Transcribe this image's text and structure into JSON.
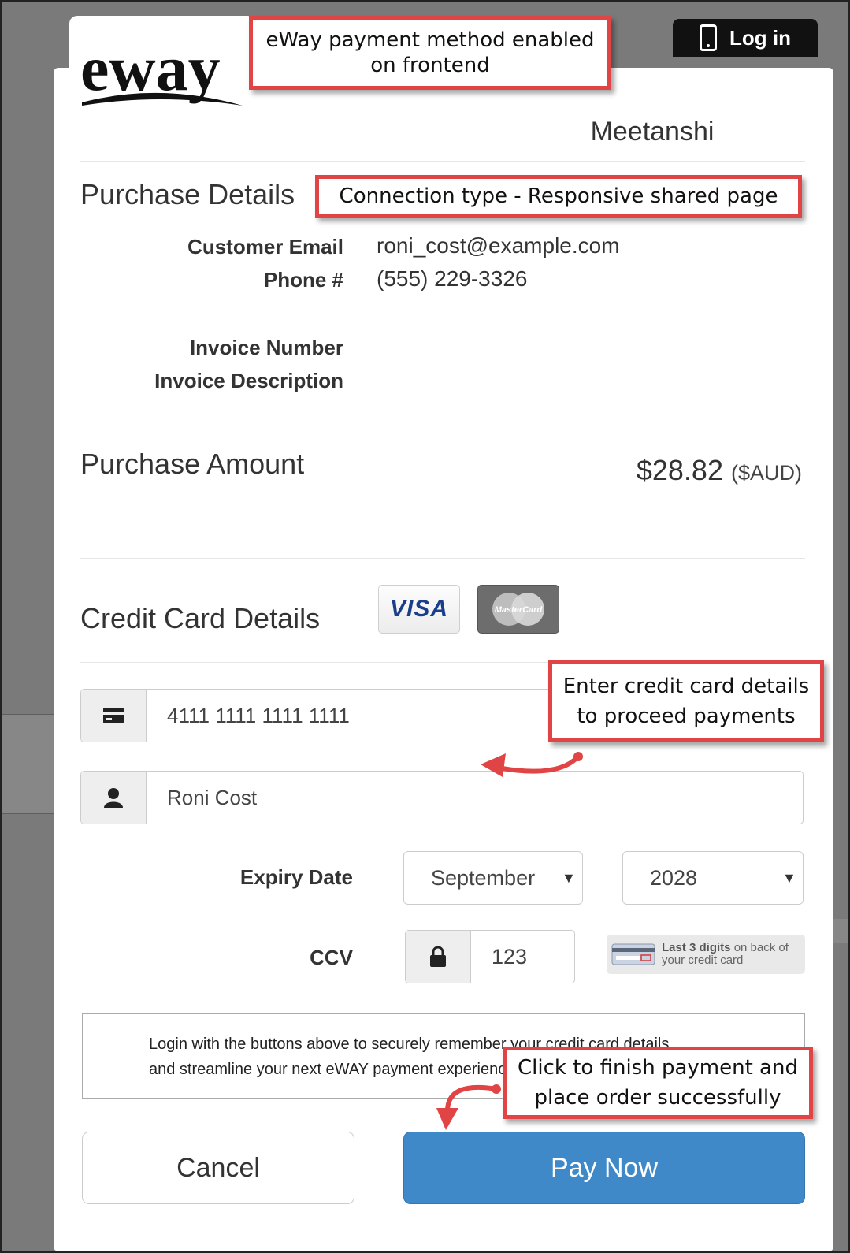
{
  "header": {
    "login_label": "Log in",
    "brand": "eway"
  },
  "merchant": {
    "name": "Meetanshi"
  },
  "purchase": {
    "section_title": "Purchase Details",
    "fields": [
      {
        "label": "Customer Email",
        "value": "roni_cost@example.com"
      },
      {
        "label": "Phone #",
        "value": "(555) 229-3326"
      },
      {
        "label": "Invoice Number",
        "value": ""
      },
      {
        "label": "Invoice Description",
        "value": ""
      }
    ],
    "amount_label": "Purchase Amount",
    "amount_value": "$28.82",
    "amount_currency": "($AUD)"
  },
  "card": {
    "section_title": "Credit Card Details",
    "brands": [
      "VISA",
      "MasterCard"
    ],
    "number": "4111 1111 1111 1111",
    "name": "Roni Cost",
    "expiry_label": "Expiry Date",
    "expiry_month": "September",
    "expiry_year": "2028",
    "ccv_label": "CCV",
    "ccv": "123",
    "ccv_hint_bold": "Last 3 digits",
    "ccv_hint_rest": "on back of your credit card"
  },
  "login_note": {
    "line1": "Login with the buttons above to securely remember your credit card details",
    "line2": "and streamline your next eWAY payment experience."
  },
  "buttons": {
    "cancel": "Cancel",
    "pay": "Pay Now"
  },
  "annotations": {
    "frontend_line1": "eWay payment method enabled",
    "frontend_line2": "on frontend",
    "connection": "Connection type - Responsive shared page",
    "card_line1": "Enter credit card details",
    "card_line2": "to proceed payments",
    "pay_line1": "Click to finish payment and",
    "pay_line2": "place order successfully"
  },
  "colors": {
    "pay_button": "#3f89c8",
    "annotation_border": "#e04444"
  }
}
